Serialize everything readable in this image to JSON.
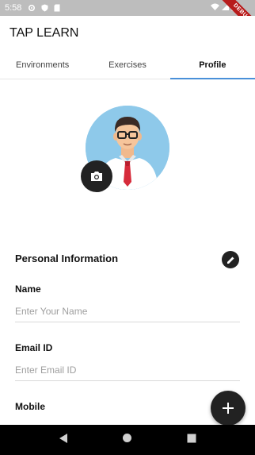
{
  "status_bar": {
    "time": "5:58",
    "debug_label": "DEBUG",
    "icons": [
      "gear-icon",
      "shield-icon",
      "sd-card-icon",
      "wifi-icon",
      "signal-icon",
      "battery-icon"
    ]
  },
  "app_bar": {
    "title": "TAP LEARN"
  },
  "tabs": [
    {
      "label": "Environments",
      "active": false
    },
    {
      "label": "Exercises",
      "active": false
    },
    {
      "label": "Profile",
      "active": true
    }
  ],
  "profile": {
    "avatar_icon": "user-avatar",
    "camera_icon": "camera-icon"
  },
  "personal_info": {
    "title": "Personal Information",
    "edit_icon": "pencil-icon",
    "fields": [
      {
        "label": "Name",
        "placeholder": "Enter Your Name",
        "value": ""
      },
      {
        "label": "Email ID",
        "placeholder": "Enter Email ID",
        "value": ""
      },
      {
        "label": "Mobile",
        "placeholder": "",
        "value": ""
      }
    ]
  },
  "fab": {
    "icon": "plus-icon"
  },
  "nav": {
    "icons": [
      "back-icon",
      "home-icon",
      "recents-icon"
    ]
  },
  "colors": {
    "tab_indicator": "#4a90d9",
    "avatar_bg": "#8ec9ea",
    "dark_button": "#222222"
  }
}
